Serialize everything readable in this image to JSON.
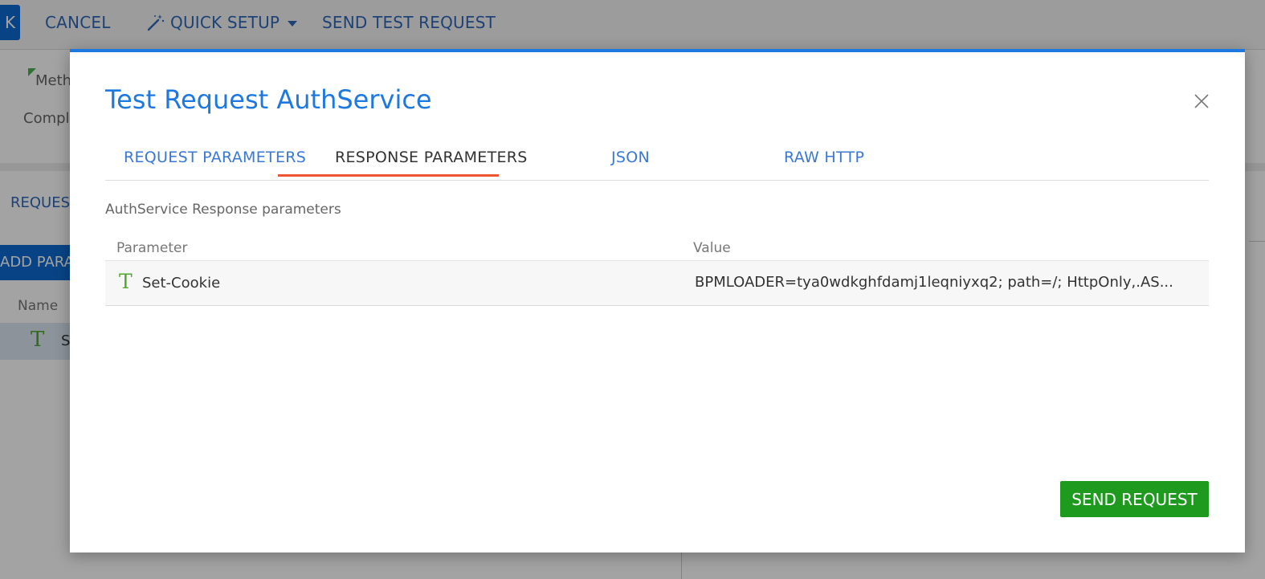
{
  "background": {
    "save_stub": "K",
    "toolbar": {
      "cancel_label": "CANCEL",
      "quick_setup_label": "QUICK SETUP",
      "send_test_label": "SEND TEST REQUEST"
    },
    "method_label": "Meth",
    "complete_label": "Comple",
    "request_tab_label": "REQUES",
    "add_param_label": "ADD PARA",
    "name_header": "Name",
    "row_type": "T",
    "row_name": "S"
  },
  "modal": {
    "title": "Test Request AuthService",
    "tabs": [
      {
        "label": "REQUEST PARAMETERS",
        "active": false
      },
      {
        "label": "RESPONSE PARAMETERS",
        "active": true
      },
      {
        "label": "JSON",
        "active": false
      },
      {
        "label": "RAW HTTP",
        "active": false
      }
    ],
    "section_caption": "AuthService Response parameters",
    "table": {
      "columns": [
        "Parameter",
        "Value"
      ],
      "rows": [
        {
          "type": "T",
          "parameter": "Set-Cookie",
          "value": "BPMLOADER=tya0wdkghfdamj1leqniyxq2; path=/; HttpOnly,.AS..."
        }
      ]
    },
    "send_button_label": "SEND REQUEST"
  },
  "colors": {
    "accent": "#1d78e0",
    "active_tab_underline": "#ef5530",
    "send_button": "#1e9b1e",
    "type_icon": "#4ea82d"
  },
  "icons": [
    "magic-wand-icon",
    "caret-down-icon",
    "close-icon",
    "text-type-icon"
  ]
}
